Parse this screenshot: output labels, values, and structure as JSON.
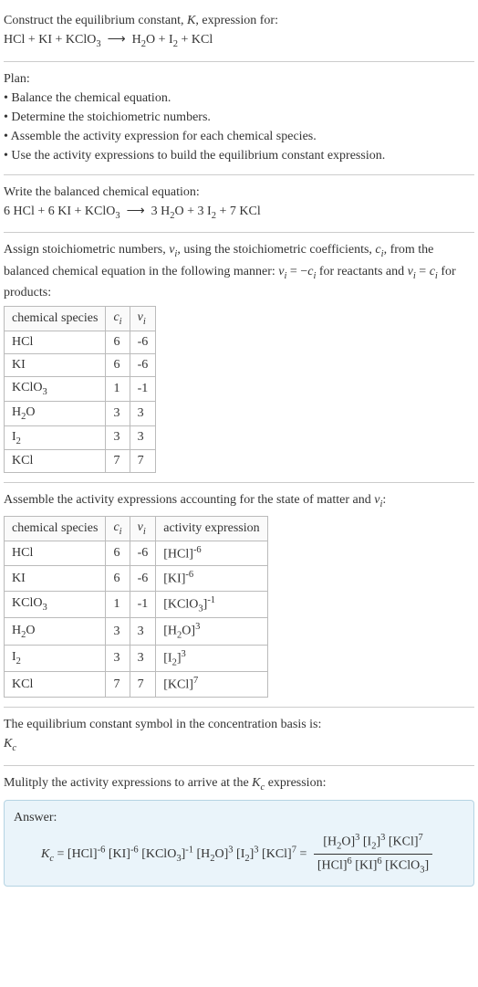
{
  "intro": {
    "title_html": "Construct the equilibrium constant, <i>K</i>, expression for:",
    "equation_html": "HCl + KI + KClO<sub>3</sub> &nbsp;⟶&nbsp; H<sub>2</sub>O + I<sub>2</sub> + KCl"
  },
  "plan": {
    "heading": "Plan:",
    "bullets": [
      "Balance the chemical equation.",
      "Determine the stoichiometric numbers.",
      "Assemble the activity expression for each chemical species.",
      "Use the activity expressions to build the equilibrium constant expression."
    ]
  },
  "balanced": {
    "heading": "Write the balanced chemical equation:",
    "equation_html": "6 HCl + 6 KI + KClO<sub>3</sub> &nbsp;⟶&nbsp; 3 H<sub>2</sub>O + 3 I<sub>2</sub> + 7 KCl"
  },
  "stoich": {
    "intro_html": "Assign stoichiometric numbers, <i>ν<sub>i</sub></i>, using the stoichiometric coefficients, <i>c<sub>i</sub></i>, from the balanced chemical equation in the following manner: <i>ν<sub>i</sub></i> = −<i>c<sub>i</sub></i> for reactants and <i>ν<sub>i</sub></i> = <i>c<sub>i</sub></i> for products:",
    "headers": {
      "species": "chemical species",
      "ci_html": "<i>c<sub>i</sub></i>",
      "vi_html": "<i>ν<sub>i</sub></i>"
    },
    "rows": [
      {
        "species_html": "HCl",
        "ci": "6",
        "vi": "-6"
      },
      {
        "species_html": "KI",
        "ci": "6",
        "vi": "-6"
      },
      {
        "species_html": "KClO<sub>3</sub>",
        "ci": "1",
        "vi": "-1"
      },
      {
        "species_html": "H<sub>2</sub>O",
        "ci": "3",
        "vi": "3"
      },
      {
        "species_html": "I<sub>2</sub>",
        "ci": "3",
        "vi": "3"
      },
      {
        "species_html": "KCl",
        "ci": "7",
        "vi": "7"
      }
    ]
  },
  "activity": {
    "intro_html": "Assemble the activity expressions accounting for the state of matter and <i>ν<sub>i</sub></i>:",
    "headers": {
      "species": "chemical species",
      "ci_html": "<i>c<sub>i</sub></i>",
      "vi_html": "<i>ν<sub>i</sub></i>",
      "activity": "activity expression"
    },
    "rows": [
      {
        "species_html": "HCl",
        "ci": "6",
        "vi": "-6",
        "expr_html": "[HCl]<sup>-6</sup>"
      },
      {
        "species_html": "KI",
        "ci": "6",
        "vi": "-6",
        "expr_html": "[KI]<sup>-6</sup>"
      },
      {
        "species_html": "KClO<sub>3</sub>",
        "ci": "1",
        "vi": "-1",
        "expr_html": "[KClO<sub>3</sub>]<sup>-1</sup>"
      },
      {
        "species_html": "H<sub>2</sub>O",
        "ci": "3",
        "vi": "3",
        "expr_html": "[H<sub>2</sub>O]<sup>3</sup>"
      },
      {
        "species_html": "I<sub>2</sub>",
        "ci": "3",
        "vi": "3",
        "expr_html": "[I<sub>2</sub>]<sup>3</sup>"
      },
      {
        "species_html": "KCl",
        "ci": "7",
        "vi": "7",
        "expr_html": "[KCl]<sup>7</sup>"
      }
    ]
  },
  "symbol": {
    "line1": "The equilibrium constant symbol in the concentration basis is:",
    "line2_html": "<i>K<sub>c</sub></i>"
  },
  "final": {
    "intro_html": "Mulitply the activity expressions to arrive at the <i>K<sub>c</sub></i> expression:",
    "answer_label": "Answer:",
    "kc_lhs_html": "<i>K<sub>c</sub></i> = [HCl]<sup>-6</sup> [KI]<sup>-6</sup> [KClO<sub>3</sub>]<sup>-1</sup> [H<sub>2</sub>O]<sup>3</sup> [I<sub>2</sub>]<sup>3</sup> [KCl]<sup>7</sup> =",
    "frac_num_html": "[H<sub>2</sub>O]<sup>3</sup> [I<sub>2</sub>]<sup>3</sup> [KCl]<sup>7</sup>",
    "frac_den_html": "[HCl]<sup>6</sup> [KI]<sup>6</sup> [KClO<sub>3</sub>]"
  }
}
